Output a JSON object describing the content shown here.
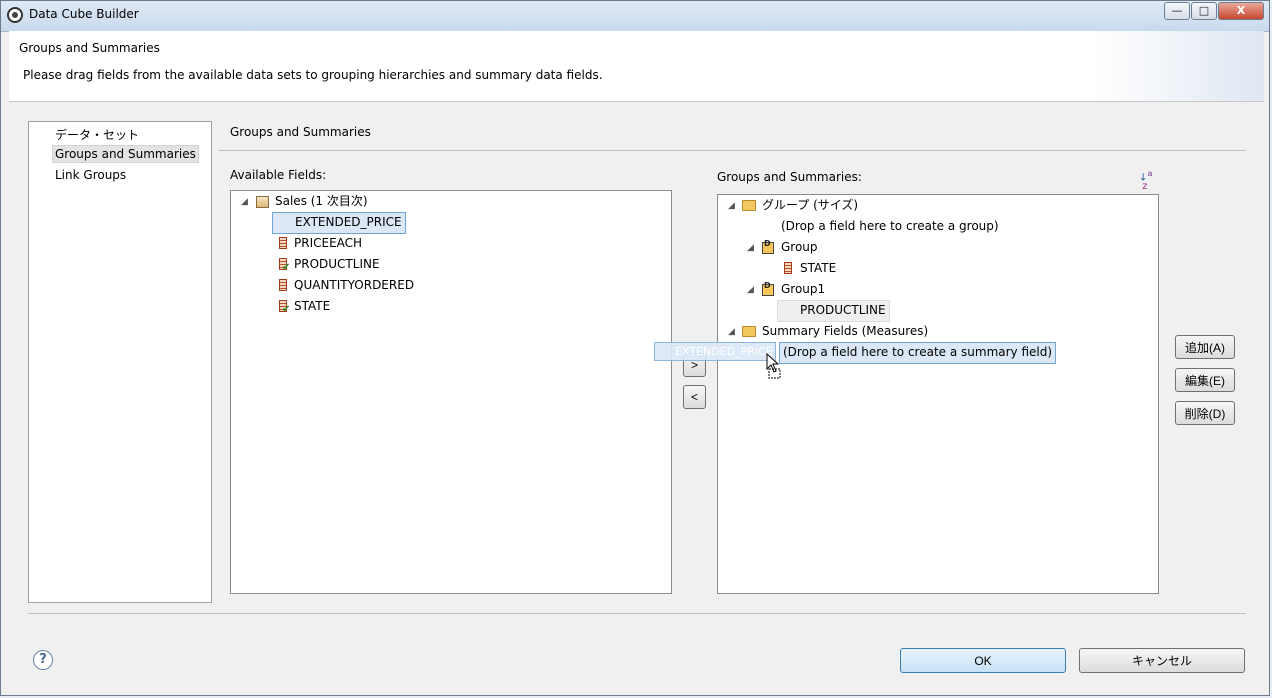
{
  "window": {
    "title": "Data Cube Builder",
    "minimize_label": "—",
    "maximize_label": "□",
    "close_label": "X"
  },
  "banner": {
    "heading": "Groups and Summaries",
    "description": "Please drag fields from the available data sets to grouping hierarchies and summary data fields."
  },
  "nav": {
    "items": [
      {
        "label": "データ・セット"
      },
      {
        "label": "Groups and Summaries"
      },
      {
        "label": "Link Groups"
      }
    ]
  },
  "section": {
    "title": "Groups and Summaries"
  },
  "available": {
    "label": "Available Fields:",
    "root": "Sales (1 次目次)",
    "fields": [
      "EXTENDED_PRICE",
      "PRICEEACH",
      "PRODUCTLINE",
      "QUANTITYORDERED",
      "STATE"
    ]
  },
  "groups": {
    "label": "Groups and Summaries:",
    "root": "グループ (サイズ)",
    "drop_group": "(Drop a field here to create a group)",
    "group_a": "Group",
    "group_a_field": "STATE",
    "group_b": "Group1",
    "group_b_field": "PRODUCTLINE",
    "summary_root": "Summary Fields (Measures)",
    "drop_summary": "(Drop a field here to create a summary field)"
  },
  "drag": {
    "label": "EXTENDED_PRICE"
  },
  "transfer": {
    "add_label": ">",
    "remove_label": "<"
  },
  "side_buttons": {
    "add": "追加(A)",
    "edit": "編集(E)",
    "delete": "削除(D)"
  },
  "footer": {
    "ok": "OK",
    "cancel": "キャンセル",
    "help": "?"
  },
  "icons": {
    "sort": "sort-az-icon"
  }
}
